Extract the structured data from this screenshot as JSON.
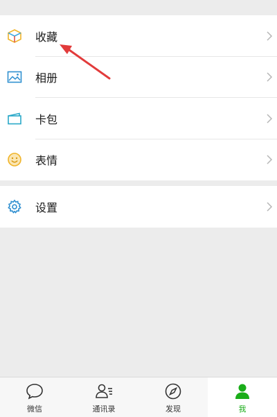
{
  "menu": {
    "items": [
      {
        "label": "收藏",
        "icon": "favorites-cube-icon"
      },
      {
        "label": "相册",
        "icon": "album-picture-icon"
      },
      {
        "label": "卡包",
        "icon": "card-wallet-icon"
      },
      {
        "label": "表情",
        "icon": "emoji-smile-icon"
      }
    ],
    "settings": {
      "label": "设置",
      "icon": "gear-icon"
    }
  },
  "tabbar": {
    "tabs": [
      {
        "label": "微信",
        "icon": "chat-bubble-icon"
      },
      {
        "label": "通讯录",
        "icon": "contacts-icon"
      },
      {
        "label": "发现",
        "icon": "compass-icon"
      },
      {
        "label": "我",
        "icon": "person-icon"
      }
    ],
    "active_index": 3
  },
  "colors": {
    "accent": "#1aad19",
    "background": "#ececec",
    "annotation_arrow": "#e23b3b",
    "icon_blue": "#2f8fd0"
  }
}
